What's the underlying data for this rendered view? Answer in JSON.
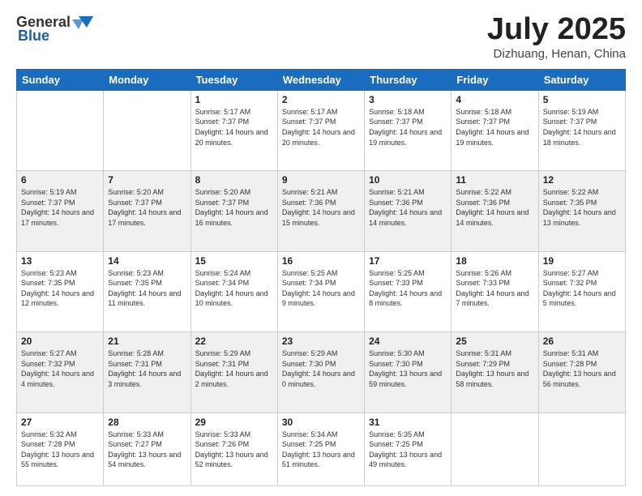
{
  "header": {
    "logo_general": "General",
    "logo_blue": "Blue",
    "month_title": "July 2025",
    "subtitle": "Dizhuang, Henan, China"
  },
  "days_of_week": [
    "Sunday",
    "Monday",
    "Tuesday",
    "Wednesday",
    "Thursday",
    "Friday",
    "Saturday"
  ],
  "weeks": [
    [
      {
        "day": "",
        "sunrise": "",
        "sunset": "",
        "daylight": ""
      },
      {
        "day": "",
        "sunrise": "",
        "sunset": "",
        "daylight": ""
      },
      {
        "day": "1",
        "sunrise": "Sunrise: 5:17 AM",
        "sunset": "Sunset: 7:37 PM",
        "daylight": "Daylight: 14 hours and 20 minutes."
      },
      {
        "day": "2",
        "sunrise": "Sunrise: 5:17 AM",
        "sunset": "Sunset: 7:37 PM",
        "daylight": "Daylight: 14 hours and 20 minutes."
      },
      {
        "day": "3",
        "sunrise": "Sunrise: 5:18 AM",
        "sunset": "Sunset: 7:37 PM",
        "daylight": "Daylight: 14 hours and 19 minutes."
      },
      {
        "day": "4",
        "sunrise": "Sunrise: 5:18 AM",
        "sunset": "Sunset: 7:37 PM",
        "daylight": "Daylight: 14 hours and 19 minutes."
      },
      {
        "day": "5",
        "sunrise": "Sunrise: 5:19 AM",
        "sunset": "Sunset: 7:37 PM",
        "daylight": "Daylight: 14 hours and 18 minutes."
      }
    ],
    [
      {
        "day": "6",
        "sunrise": "Sunrise: 5:19 AM",
        "sunset": "Sunset: 7:37 PM",
        "daylight": "Daylight: 14 hours and 17 minutes."
      },
      {
        "day": "7",
        "sunrise": "Sunrise: 5:20 AM",
        "sunset": "Sunset: 7:37 PM",
        "daylight": "Daylight: 14 hours and 17 minutes."
      },
      {
        "day": "8",
        "sunrise": "Sunrise: 5:20 AM",
        "sunset": "Sunset: 7:37 PM",
        "daylight": "Daylight: 14 hours and 16 minutes."
      },
      {
        "day": "9",
        "sunrise": "Sunrise: 5:21 AM",
        "sunset": "Sunset: 7:36 PM",
        "daylight": "Daylight: 14 hours and 15 minutes."
      },
      {
        "day": "10",
        "sunrise": "Sunrise: 5:21 AM",
        "sunset": "Sunset: 7:36 PM",
        "daylight": "Daylight: 14 hours and 14 minutes."
      },
      {
        "day": "11",
        "sunrise": "Sunrise: 5:22 AM",
        "sunset": "Sunset: 7:36 PM",
        "daylight": "Daylight: 14 hours and 14 minutes."
      },
      {
        "day": "12",
        "sunrise": "Sunrise: 5:22 AM",
        "sunset": "Sunset: 7:35 PM",
        "daylight": "Daylight: 14 hours and 13 minutes."
      }
    ],
    [
      {
        "day": "13",
        "sunrise": "Sunrise: 5:23 AM",
        "sunset": "Sunset: 7:35 PM",
        "daylight": "Daylight: 14 hours and 12 minutes."
      },
      {
        "day": "14",
        "sunrise": "Sunrise: 5:23 AM",
        "sunset": "Sunset: 7:35 PM",
        "daylight": "Daylight: 14 hours and 11 minutes."
      },
      {
        "day": "15",
        "sunrise": "Sunrise: 5:24 AM",
        "sunset": "Sunset: 7:34 PM",
        "daylight": "Daylight: 14 hours and 10 minutes."
      },
      {
        "day": "16",
        "sunrise": "Sunrise: 5:25 AM",
        "sunset": "Sunset: 7:34 PM",
        "daylight": "Daylight: 14 hours and 9 minutes."
      },
      {
        "day": "17",
        "sunrise": "Sunrise: 5:25 AM",
        "sunset": "Sunset: 7:33 PM",
        "daylight": "Daylight: 14 hours and 8 minutes."
      },
      {
        "day": "18",
        "sunrise": "Sunrise: 5:26 AM",
        "sunset": "Sunset: 7:33 PM",
        "daylight": "Daylight: 14 hours and 7 minutes."
      },
      {
        "day": "19",
        "sunrise": "Sunrise: 5:27 AM",
        "sunset": "Sunset: 7:32 PM",
        "daylight": "Daylight: 14 hours and 5 minutes."
      }
    ],
    [
      {
        "day": "20",
        "sunrise": "Sunrise: 5:27 AM",
        "sunset": "Sunset: 7:32 PM",
        "daylight": "Daylight: 14 hours and 4 minutes."
      },
      {
        "day": "21",
        "sunrise": "Sunrise: 5:28 AM",
        "sunset": "Sunset: 7:31 PM",
        "daylight": "Daylight: 14 hours and 3 minutes."
      },
      {
        "day": "22",
        "sunrise": "Sunrise: 5:29 AM",
        "sunset": "Sunset: 7:31 PM",
        "daylight": "Daylight: 14 hours and 2 minutes."
      },
      {
        "day": "23",
        "sunrise": "Sunrise: 5:29 AM",
        "sunset": "Sunset: 7:30 PM",
        "daylight": "Daylight: 14 hours and 0 minutes."
      },
      {
        "day": "24",
        "sunrise": "Sunrise: 5:30 AM",
        "sunset": "Sunset: 7:30 PM",
        "daylight": "Daylight: 13 hours and 59 minutes."
      },
      {
        "day": "25",
        "sunrise": "Sunrise: 5:31 AM",
        "sunset": "Sunset: 7:29 PM",
        "daylight": "Daylight: 13 hours and 58 minutes."
      },
      {
        "day": "26",
        "sunrise": "Sunrise: 5:31 AM",
        "sunset": "Sunset: 7:28 PM",
        "daylight": "Daylight: 13 hours and 56 minutes."
      }
    ],
    [
      {
        "day": "27",
        "sunrise": "Sunrise: 5:32 AM",
        "sunset": "Sunset: 7:28 PM",
        "daylight": "Daylight: 13 hours and 55 minutes."
      },
      {
        "day": "28",
        "sunrise": "Sunrise: 5:33 AM",
        "sunset": "Sunset: 7:27 PM",
        "daylight": "Daylight: 13 hours and 54 minutes."
      },
      {
        "day": "29",
        "sunrise": "Sunrise: 5:33 AM",
        "sunset": "Sunset: 7:26 PM",
        "daylight": "Daylight: 13 hours and 52 minutes."
      },
      {
        "day": "30",
        "sunrise": "Sunrise: 5:34 AM",
        "sunset": "Sunset: 7:25 PM",
        "daylight": "Daylight: 13 hours and 51 minutes."
      },
      {
        "day": "31",
        "sunrise": "Sunrise: 5:35 AM",
        "sunset": "Sunset: 7:25 PM",
        "daylight": "Daylight: 13 hours and 49 minutes."
      },
      {
        "day": "",
        "sunrise": "",
        "sunset": "",
        "daylight": ""
      },
      {
        "day": "",
        "sunrise": "",
        "sunset": "",
        "daylight": ""
      }
    ]
  ]
}
